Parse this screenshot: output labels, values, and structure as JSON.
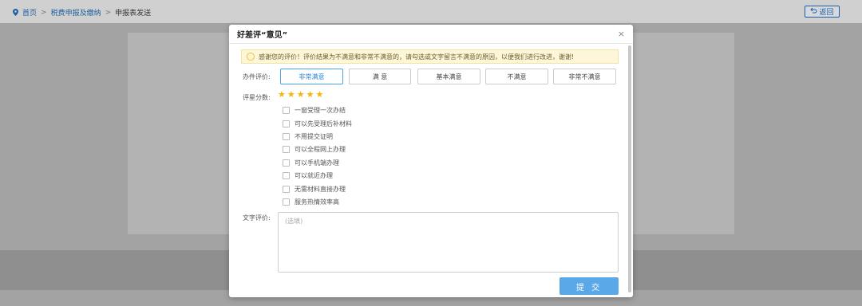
{
  "breadcrumb": {
    "home": "首页",
    "section": "税费申报及缴纳",
    "current": "申报表发送"
  },
  "back_button": "返回",
  "modal": {
    "title": "好差评“意见”",
    "close": "×",
    "notice": "感谢您的评价！评价结果为不满意和非常不满意的，请勾选或文字留言不满意的原因，以便我们进行改进，谢谢!",
    "rating_label": "办件评价:",
    "rating_options": [
      "非常满意",
      "满 意",
      "基本满意",
      "不满意",
      "非常不满意"
    ],
    "selected_rating": "非常满意",
    "score_label": "评星分数:",
    "stars": 5,
    "reasons": [
      "一窗受理一次办结",
      "可以先受理后补材料",
      "不用提交证明",
      "可以全程网上办理",
      "可以手机端办理",
      "可以就近办理",
      "无需材料直接办理",
      "服务热情效率高"
    ],
    "text_label": "文字评价:",
    "text_placeholder": "(选填)",
    "submit": "提 交"
  },
  "colors": {
    "accent": "#4aa4e6",
    "submit": "#5aa8e8",
    "star": "#f4b400",
    "notice_bg": "#fdf6d8"
  }
}
